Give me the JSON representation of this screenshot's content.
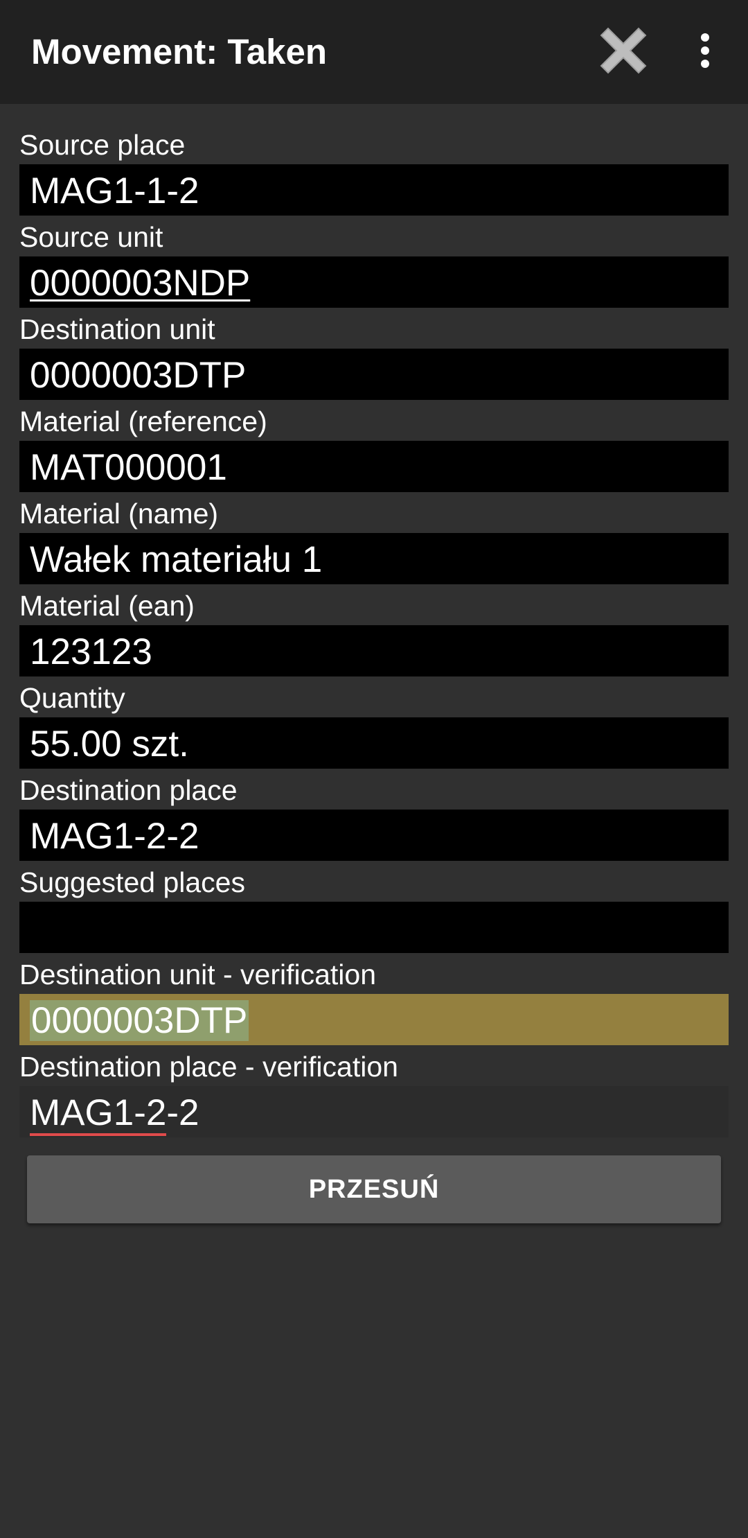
{
  "appbar": {
    "title": "Movement: Taken",
    "icons": {
      "close": "close-x-icon",
      "more": "more-vert-icon"
    }
  },
  "fields": {
    "source_place": {
      "label": "Source place",
      "value": "MAG1-1-2"
    },
    "source_unit": {
      "label": "Source unit",
      "value": "0000003NDP"
    },
    "destination_unit": {
      "label": "Destination unit",
      "value": "0000003DTP"
    },
    "material_reference": {
      "label": "Material (reference)",
      "value": "MAT000001"
    },
    "material_name": {
      "label": "Material (name)",
      "value": "Wałek materiału 1"
    },
    "material_ean": {
      "label": "Material (ean)",
      "value": "123123"
    },
    "quantity": {
      "label": "Quantity",
      "value": "55.00 szt."
    },
    "destination_place": {
      "label": "Destination place",
      "value": "MAG1-2-2"
    },
    "suggested_places": {
      "label": "Suggested places",
      "value": ""
    },
    "destination_unit_verification": {
      "label": "Destination unit - verification",
      "value": "0000003DTP"
    },
    "destination_place_verification": {
      "label": "Destination place - verification",
      "value_marked": "MAG1-2",
      "value_rest": "-2"
    }
  },
  "actions": {
    "move_label": "PRZESUŃ"
  },
  "colors": {
    "background": "#303030",
    "appbar": "#212121",
    "field": "#000000",
    "highlight_field": "#94803f",
    "highlight_text": "#8f9f6d",
    "button": "#5b5b5b",
    "spellcheck": "#e04b4b"
  }
}
